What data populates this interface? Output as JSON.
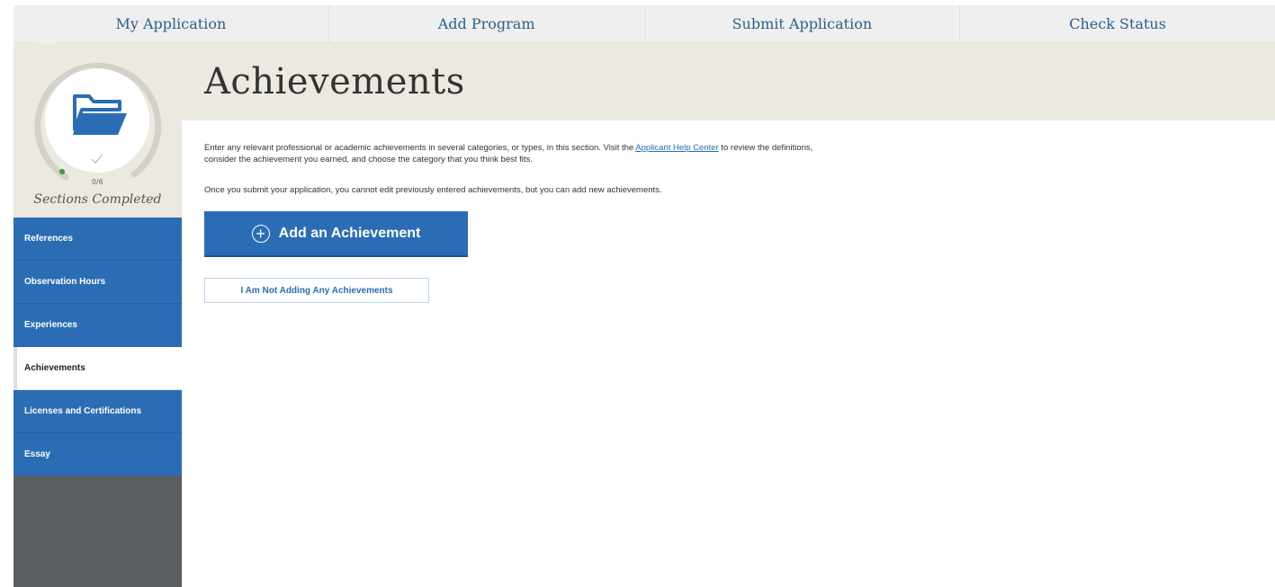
{
  "topnav": {
    "tabs": [
      {
        "label": "My Application"
      },
      {
        "label": "Add Program"
      },
      {
        "label": "Submit Application"
      },
      {
        "label": "Check Status"
      }
    ]
  },
  "progress": {
    "count": "0/6",
    "completed_fraction": 0,
    "caption": "Sections Completed",
    "icon": "folder-icon",
    "ring_color": "#c9c7bf",
    "accent_color": "#2a6db4"
  },
  "sidebar": {
    "items": [
      {
        "label": "References"
      },
      {
        "label": "Observation Hours"
      },
      {
        "label": "Experiences"
      },
      {
        "label": "Achievements"
      },
      {
        "label": "Licenses and Certifications"
      },
      {
        "label": "Essay"
      }
    ]
  },
  "page": {
    "title": "Achievements",
    "intro_before_link": "Enter any relevant professional or academic achievements in several categories, or types, in this section. Visit the ",
    "help_link": "Applicant Help Center",
    "intro_after_link": " to review the definitions, consider the achievement you earned, and choose the category that you think best fits.",
    "note": "Once you submit your application, you cannot edit previously entered achievements, but you can add new achievements.",
    "add_button": "Add an Achievement",
    "not_adding_button": "I Am Not Adding Any Achievements"
  }
}
